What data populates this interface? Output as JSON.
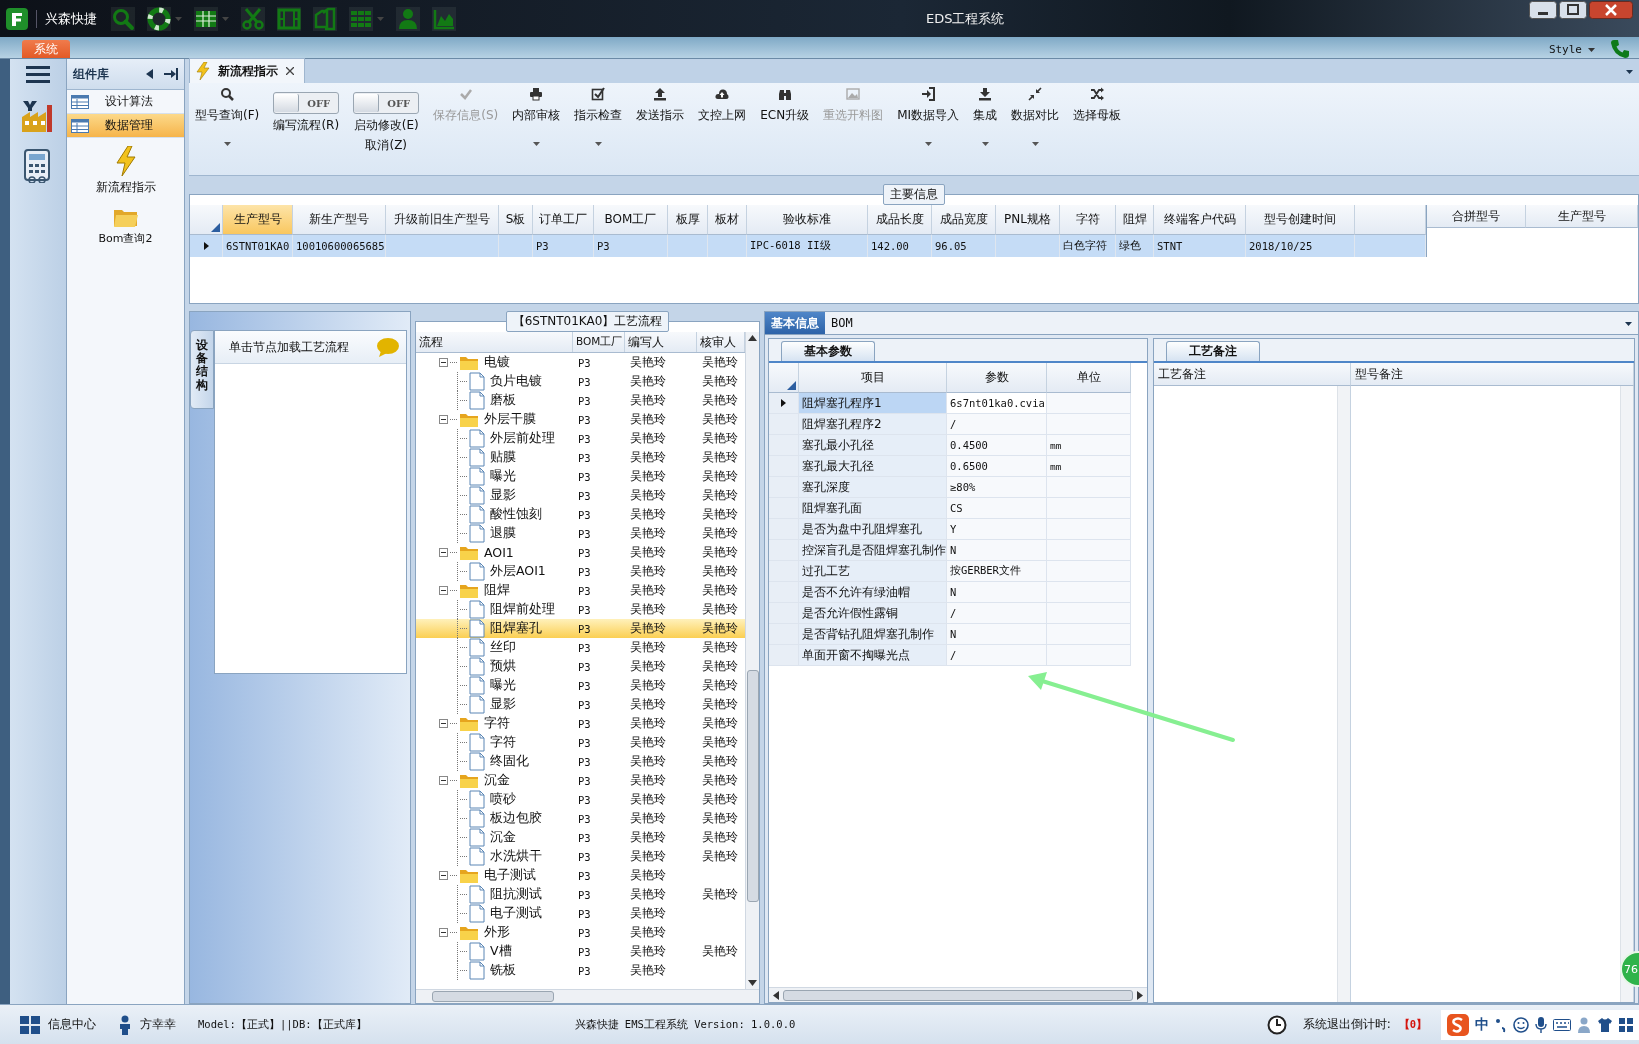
{
  "window": {
    "title": "EDS工程系统",
    "app_name": "兴森快捷",
    "style_label": "Style"
  },
  "menu_tabs": [
    {
      "label": "系统",
      "selected": true
    }
  ],
  "component_library": {
    "title": "组件库",
    "items": [
      {
        "label": "设计算法",
        "selected": false
      },
      {
        "label": "数据管理",
        "selected": true
      }
    ],
    "tools": [
      {
        "label": "新流程指示"
      },
      {
        "label": "Bom查询2"
      }
    ]
  },
  "document_tab": {
    "label": "新流程指示"
  },
  "toolbar": [
    {
      "kind": "button",
      "label": "型号查询(F)",
      "dropdown": true,
      "disabled": false
    },
    {
      "kind": "toggle",
      "label": "编写流程(R)",
      "state_text": "OFF",
      "on": false
    },
    {
      "kind": "toggle",
      "label": "启动修改(E)",
      "second_label": "取消(Z)",
      "state_text": "OFF",
      "on": false
    },
    {
      "kind": "button",
      "label": "保存信息(S)",
      "dropdown": false,
      "disabled": true
    },
    {
      "kind": "button",
      "label": "内部审核",
      "dropdown": true,
      "disabled": false
    },
    {
      "kind": "button",
      "label": "指示检查",
      "dropdown": true,
      "disabled": false
    },
    {
      "kind": "button",
      "label": "发送指示",
      "dropdown": false,
      "disabled": false
    },
    {
      "kind": "button",
      "label": "文控上网",
      "dropdown": false,
      "disabled": false
    },
    {
      "kind": "button",
      "label": "ECN升级",
      "dropdown": false,
      "disabled": false
    },
    {
      "kind": "button",
      "label": "重选开料图",
      "dropdown": false,
      "disabled": true
    },
    {
      "kind": "button",
      "label": "MI数据导入",
      "dropdown": true,
      "disabled": false
    },
    {
      "kind": "button",
      "label": "集成",
      "dropdown": true,
      "disabled": false
    },
    {
      "kind": "button",
      "label": "数据对比",
      "dropdown": true,
      "disabled": false
    },
    {
      "kind": "button",
      "label": "选择母板",
      "dropdown": false,
      "disabled": false
    }
  ],
  "main_info": {
    "title": "主要信息",
    "columns": [
      {
        "label": "生产型号",
        "selected": true
      },
      {
        "label": "新生产型号",
        "selected": false
      },
      {
        "label": "升级前旧生产型号",
        "selected": false
      },
      {
        "label": "S板",
        "selected": false
      },
      {
        "label": "订单工厂",
        "selected": false
      },
      {
        "label": "BOM工厂",
        "selected": false
      },
      {
        "label": "板厚",
        "selected": false
      },
      {
        "label": "板材",
        "selected": false
      },
      {
        "label": "验收标准",
        "selected": false
      },
      {
        "label": "成品长度",
        "selected": false
      },
      {
        "label": "成品宽度",
        "selected": false
      },
      {
        "label": "PNL规格",
        "selected": false
      },
      {
        "label": "字符",
        "selected": false
      },
      {
        "label": "阻焊",
        "selected": false
      },
      {
        "label": "终端客户代码",
        "selected": false
      },
      {
        "label": "型号创建时间",
        "selected": false
      }
    ],
    "rows": [
      {
        "selected": true,
        "cells": [
          "6STNT01KA0",
          "10010600065685",
          null,
          null,
          "P3",
          "P3",
          null,
          null,
          "IPC-6018 II级",
          "142.00",
          "96.05",
          null,
          "白色字符",
          "绿色",
          "STNT",
          "2018/10/25"
        ]
      }
    ],
    "side_columns": [
      "合拼型号",
      "生产型号"
    ]
  },
  "equipment_panel": {
    "tab": "设备结构",
    "header": "单击节点加载工艺流程"
  },
  "process_tree": {
    "title": "【6STNT01KA0】工艺流程",
    "columns": [
      "流程",
      "BOM工厂",
      "编写人",
      "核审人"
    ],
    "nodes": [
      {
        "name": "电镀",
        "factory": "P3",
        "writer": "吴艳玲",
        "reviewer": "吴艳玲",
        "expanded": true,
        "selected": false,
        "children": [
          {
            "name": "负片电镀",
            "factory": "P3",
            "writer": "吴艳玲",
            "reviewer": "吴艳玲",
            "selected": false
          },
          {
            "name": "磨板",
            "factory": "P3",
            "writer": "吴艳玲",
            "reviewer": "吴艳玲",
            "selected": false
          }
        ]
      },
      {
        "name": "外层干膜",
        "factory": "P3",
        "writer": "吴艳玲",
        "reviewer": "吴艳玲",
        "expanded": true,
        "selected": false,
        "children": [
          {
            "name": "外层前处理",
            "factory": "P3",
            "writer": "吴艳玲",
            "reviewer": "吴艳玲",
            "selected": false
          },
          {
            "name": "贴膜",
            "factory": "P3",
            "writer": "吴艳玲",
            "reviewer": "吴艳玲",
            "selected": false
          },
          {
            "name": "曝光",
            "factory": "P3",
            "writer": "吴艳玲",
            "reviewer": "吴艳玲",
            "selected": false
          },
          {
            "name": "显影",
            "factory": "P3",
            "writer": "吴艳玲",
            "reviewer": "吴艳玲",
            "selected": false
          },
          {
            "name": "酸性蚀刻",
            "factory": "P3",
            "writer": "吴艳玲",
            "reviewer": "吴艳玲",
            "selected": false
          },
          {
            "name": "退膜",
            "factory": "P3",
            "writer": "吴艳玲",
            "reviewer": "吴艳玲",
            "selected": false
          }
        ]
      },
      {
        "name": "AOI1",
        "factory": "P3",
        "writer": "吴艳玲",
        "reviewer": "吴艳玲",
        "expanded": true,
        "selected": false,
        "children": [
          {
            "name": "外层AOI1",
            "factory": "P3",
            "writer": "吴艳玲",
            "reviewer": "吴艳玲",
            "selected": false
          }
        ]
      },
      {
        "name": "阻焊",
        "factory": "P3",
        "writer": "吴艳玲",
        "reviewer": "吴艳玲",
        "expanded": true,
        "selected": false,
        "children": [
          {
            "name": "阻焊前处理",
            "factory": "P3",
            "writer": "吴艳玲",
            "reviewer": "吴艳玲",
            "selected": false
          },
          {
            "name": "阻焊塞孔",
            "factory": "P3",
            "writer": "吴艳玲",
            "reviewer": "吴艳玲",
            "selected": true
          },
          {
            "name": "丝印",
            "factory": "P3",
            "writer": "吴艳玲",
            "reviewer": "吴艳玲",
            "selected": false
          },
          {
            "name": "预烘",
            "factory": "P3",
            "writer": "吴艳玲",
            "reviewer": "吴艳玲",
            "selected": false
          },
          {
            "name": "曝光",
            "factory": "P3",
            "writer": "吴艳玲",
            "reviewer": "吴艳玲",
            "selected": false
          },
          {
            "name": "显影",
            "factory": "P3",
            "writer": "吴艳玲",
            "reviewer": "吴艳玲",
            "selected": false
          }
        ]
      },
      {
        "name": "字符",
        "factory": "P3",
        "writer": "吴艳玲",
        "reviewer": "吴艳玲",
        "expanded": true,
        "selected": false,
        "children": [
          {
            "name": "字符",
            "factory": "P3",
            "writer": "吴艳玲",
            "reviewer": "吴艳玲",
            "selected": false
          },
          {
            "name": "终固化",
            "factory": "P3",
            "writer": "吴艳玲",
            "reviewer": "吴艳玲",
            "selected": false
          }
        ]
      },
      {
        "name": "沉金",
        "factory": "P3",
        "writer": "吴艳玲",
        "reviewer": "吴艳玲",
        "expanded": true,
        "selected": false,
        "children": [
          {
            "name": "喷砂",
            "factory": "P3",
            "writer": "吴艳玲",
            "reviewer": "吴艳玲",
            "selected": false
          },
          {
            "name": "板边包胶",
            "factory": "P3",
            "writer": "吴艳玲",
            "reviewer": "吴艳玲",
            "selected": false
          },
          {
            "name": "沉金",
            "factory": "P3",
            "writer": "吴艳玲",
            "reviewer": "吴艳玲",
            "selected": false
          },
          {
            "name": "水洗烘干",
            "factory": "P3",
            "writer": "吴艳玲",
            "reviewer": "吴艳玲",
            "selected": false
          }
        ]
      },
      {
        "name": "电子测试",
        "factory": "P3",
        "writer": "吴艳玲",
        "expanded": true,
        "selected": false,
        "children": [
          {
            "name": "阻抗测试",
            "factory": "P3",
            "writer": "吴艳玲",
            "reviewer": "吴艳玲",
            "selected": false
          },
          {
            "name": "电子测试",
            "factory": "P3",
            "writer": "吴艳玲",
            "selected": false
          }
        ]
      },
      {
        "name": "外形",
        "factory": "P3",
        "writer": "吴艳玲",
        "expanded": true,
        "selected": false,
        "children": [
          {
            "name": "V槽",
            "factory": "P3",
            "writer": "吴艳玲",
            "reviewer": "吴艳玲",
            "selected": false
          },
          {
            "name": "铣板",
            "factory": "P3",
            "writer": "吴艳玲",
            "selected": false
          }
        ]
      }
    ]
  },
  "detail_tabs": [
    {
      "label": "基本信息",
      "selected": true
    },
    {
      "label": "BOM",
      "selected": false
    }
  ],
  "basic_params": {
    "tab": "基本参数",
    "columns": [
      "项目",
      "参数",
      "单位"
    ],
    "rows": [
      {
        "item": "阻焊塞孔程序1",
        "value": "6s7nt01ka0.cvia",
        "selected": true
      },
      {
        "item": "阻焊塞孔程序2",
        "value": "/",
        "selected": false
      },
      {
        "item": "塞孔最小孔径",
        "value": "0.4500",
        "unit": "mm",
        "selected": false
      },
      {
        "item": "塞孔最大孔径",
        "value": "0.6500",
        "unit": "mm",
        "selected": false
      },
      {
        "item": "塞孔深度",
        "value": "≥80%",
        "selected": false
      },
      {
        "item": "阻焊塞孔面",
        "value": "CS",
        "selected": false
      },
      {
        "item": "是否为盘中孔阻焊塞孔",
        "value": "Y",
        "selected": false
      },
      {
        "item": "控深盲孔是否阻焊塞孔制作",
        "value": "N",
        "selected": false
      },
      {
        "item": "过孔工艺",
        "value": "按GERBER文件",
        "selected": false
      },
      {
        "item": "是否不允许有绿油帽",
        "value": "N",
        "selected": false
      },
      {
        "item": "是否允许假性露铜",
        "value": "/",
        "selected": false
      },
      {
        "item": "是否背钻孔阻焊塞孔制作",
        "value": "N",
        "selected": false
      },
      {
        "item": "单面开窗不掏曝光点",
        "value": "/",
        "selected": false
      }
    ]
  },
  "process_notes": {
    "tab": "工艺备注",
    "columns": [
      "工艺备注",
      "型号备注"
    ]
  },
  "status_bar": {
    "message_center": "信息中心",
    "user": "方幸幸",
    "environment": "Model:【正式】||DB:【正式库】",
    "version": "兴森快捷 EMS工程系统 Version: 1.0.0.0",
    "countdown_label": "系统退出倒计时:",
    "countdown_value": "【0】",
    "ime_mode": "中"
  },
  "badge": {
    "text": "76"
  }
}
